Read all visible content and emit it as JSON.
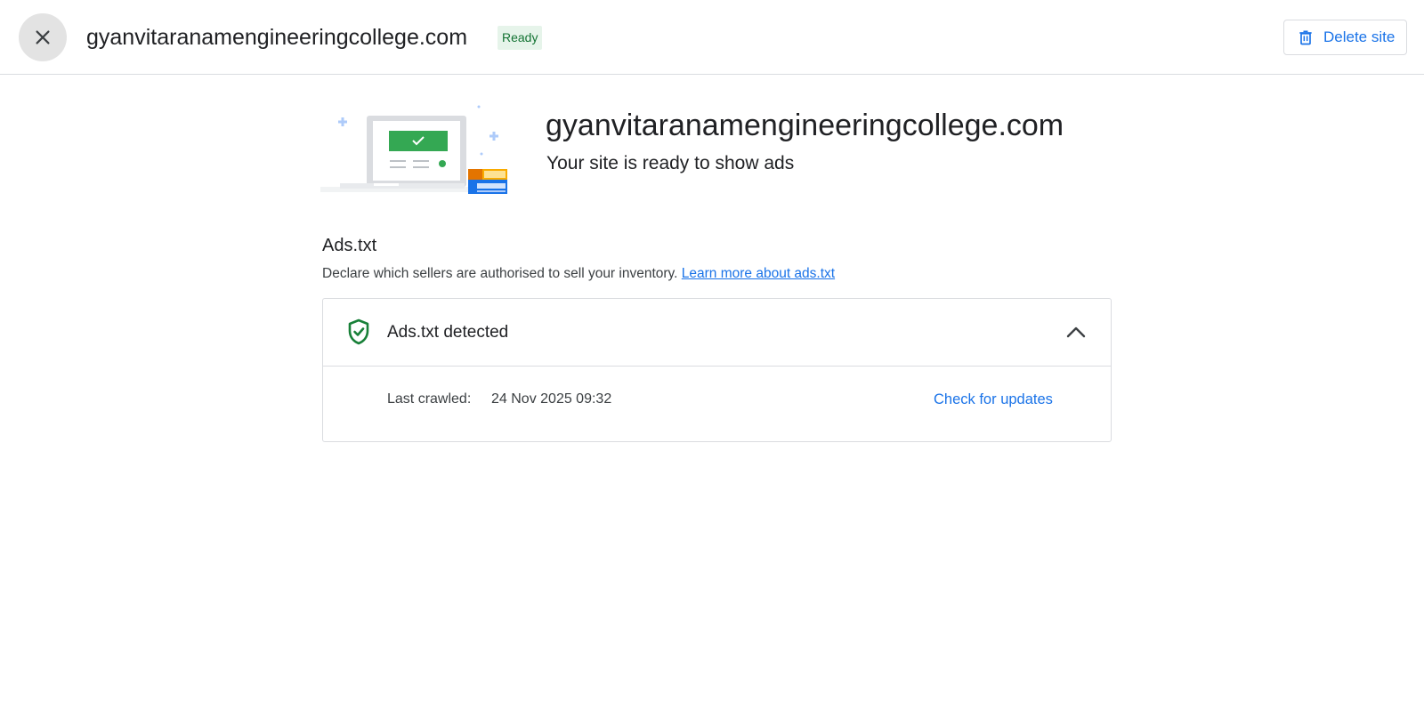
{
  "header": {
    "title": "gyanvitaranamengineeringcollege.com",
    "status": "Ready",
    "delete_label": "Delete site",
    "close_icon": "close-icon",
    "delete_icon": "trash-icon"
  },
  "hero": {
    "title": "gyanvitaranamengineeringcollege.com",
    "subtitle": "Your site is ready to show ads"
  },
  "ads_txt": {
    "heading": "Ads.txt",
    "description": "Declare which sellers are authorised to sell your inventory.",
    "learn_more": "Learn more about ads.txt",
    "panel": {
      "title": "Ads.txt detected",
      "status_icon": "shield-check-icon",
      "expand_icon": "chevron-up-icon",
      "last_crawled_label": "Last crawled:",
      "last_crawled_value": "24 Nov 2025 09:32",
      "check_updates": "Check for updates"
    }
  },
  "colors": {
    "accent": "#1a73e8",
    "success": "#188038",
    "badge_bg": "#e6f4ea",
    "badge_text": "#137333",
    "border": "#dadce0"
  }
}
